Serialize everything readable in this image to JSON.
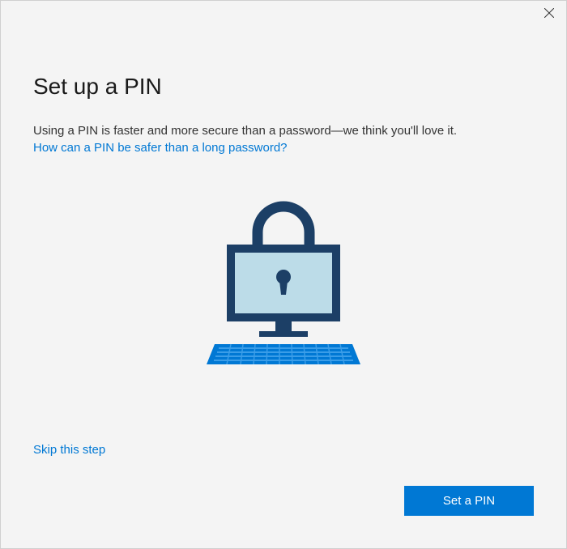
{
  "heading": "Set up a PIN",
  "description": "Using a PIN is faster and more secure than a password—we think you'll love it.",
  "help_link": "How can a PIN be safer than a long password?",
  "skip_link": "Skip this step",
  "primary_button": "Set a PIN"
}
